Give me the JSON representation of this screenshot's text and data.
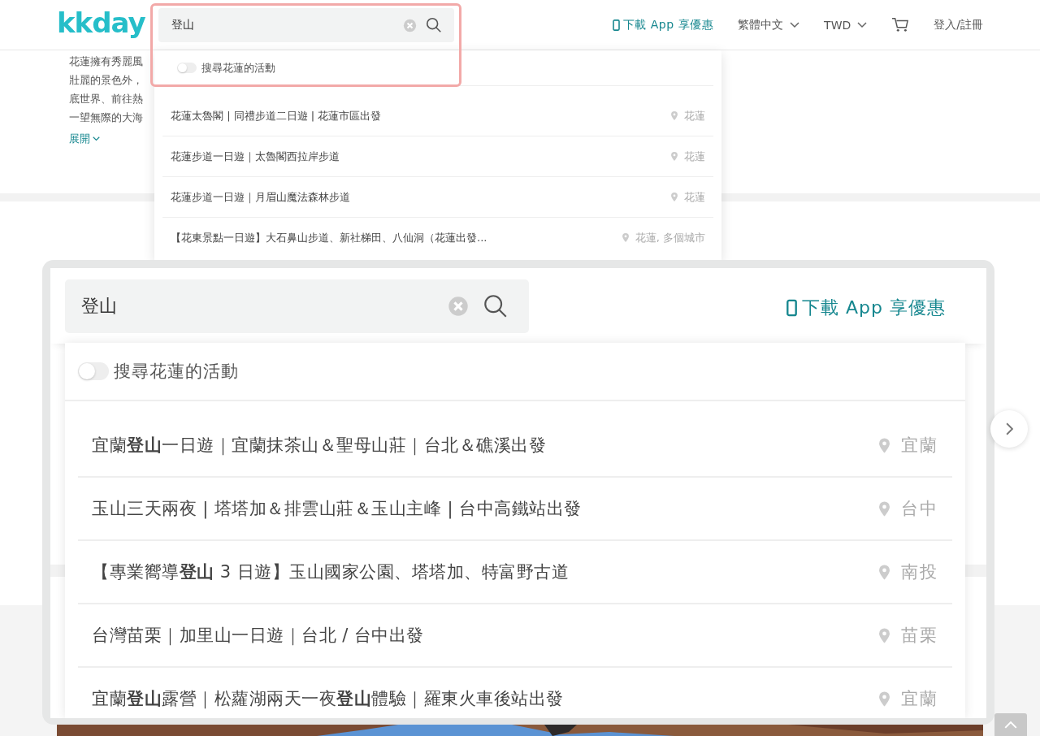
{
  "header": {
    "logo": "kkday",
    "search": {
      "value": "登山"
    },
    "app_promo": "下載 App 享優惠",
    "language": "繁體中文",
    "currency": "TWD",
    "login": "登入/註冊"
  },
  "description": {
    "lines": [
      "花蓮擁有秀麗風",
      "壯麗的景色外，",
      "底世界、前往熱",
      "一望無際的大海"
    ],
    "expand": "展開"
  },
  "dropdown": {
    "toggle": {
      "label": "搜尋花蓮的活動",
      "on": false
    },
    "results": [
      {
        "title": "花蓮太魯閣 | 同禮步道二日遊 | 花蓮市區出發",
        "location": "花蓮"
      },
      {
        "title": "花蓮步道一日遊｜太魯閣西拉岸步道",
        "location": "花蓮"
      },
      {
        "title": "花蓮步道一日遊｜月眉山魔法森林步道",
        "location": "花蓮"
      },
      {
        "title": "【花東景點一日遊】大石鼻山步道、新社梯田、八仙洞（花蓮出發...",
        "location": "花蓮, 多個城市"
      }
    ]
  },
  "zoom_inset": {
    "search": {
      "value": "登山"
    },
    "app_promo": "下載 App 享優惠",
    "dropdown": {
      "toggle": {
        "label": "搜尋花蓮的活動",
        "on": false
      },
      "results": [
        {
          "title": "宜蘭**登山**一日遊｜宜蘭抹茶山＆聖母山莊｜台北＆礁溪出發",
          "location": "宜蘭"
        },
        {
          "title": "玉山三天兩夜 | 塔塔加＆排雲山莊＆玉山主峰 | 台中高鐵站出發",
          "location": "台中"
        },
        {
          "title": "【專業嚮導**登山** 3 日遊】玉山國家公園、塔塔加、特富野古道",
          "location": "南投"
        },
        {
          "title": "台灣苗栗｜加里山一日遊｜台北 / 台中出發",
          "location": "苗栗"
        },
        {
          "title": "宜蘭**登山**露營｜松蘿湖兩天一夜**登山**體驗｜羅東火車後站出發",
          "location": "宜蘭"
        }
      ]
    }
  }
}
